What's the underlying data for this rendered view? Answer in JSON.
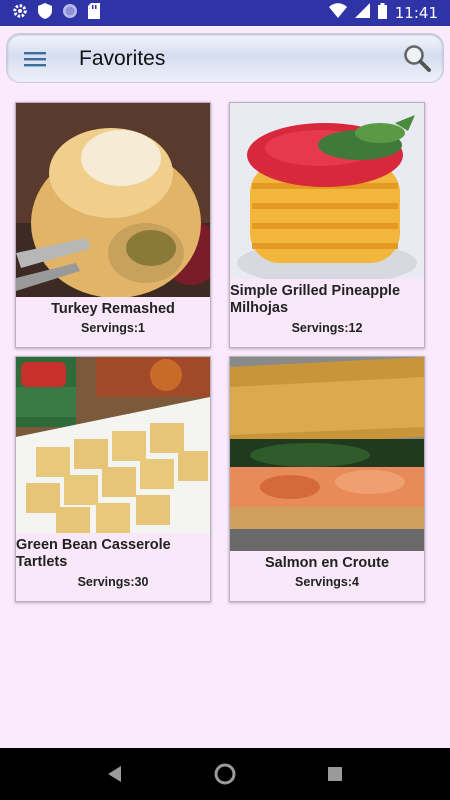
{
  "status_bar": {
    "time": "11:41",
    "left_icons": [
      "gear-icon",
      "shield-icon",
      "circle-icon",
      "sd-card-icon"
    ],
    "right_icons": [
      "wifi-icon",
      "signal-icon",
      "battery-icon"
    ],
    "color": "#2e33a6"
  },
  "app_bar": {
    "title": "Favorites",
    "menu_icon": "hamburger-menu-icon",
    "search_icon": "search-icon"
  },
  "recipes": [
    {
      "title": "Turkey Remashed",
      "servings": "Servings:1",
      "image": "turkey-remashed-photo"
    },
    {
      "title": "Simple Grilled Pineapple Milhojas",
      "servings": "Servings:12",
      "image": "pineapple-milhojas-photo"
    },
    {
      "title": "Green Bean Casserole Tartlets",
      "servings": "Servings:30",
      "image": "green-bean-tartlets-photo"
    },
    {
      "title": "Salmon en Croute",
      "servings": "Servings:4",
      "image": "salmon-en-croute-photo"
    }
  ],
  "nav_bar": {
    "buttons": [
      "back-icon",
      "home-icon",
      "recents-icon"
    ]
  }
}
